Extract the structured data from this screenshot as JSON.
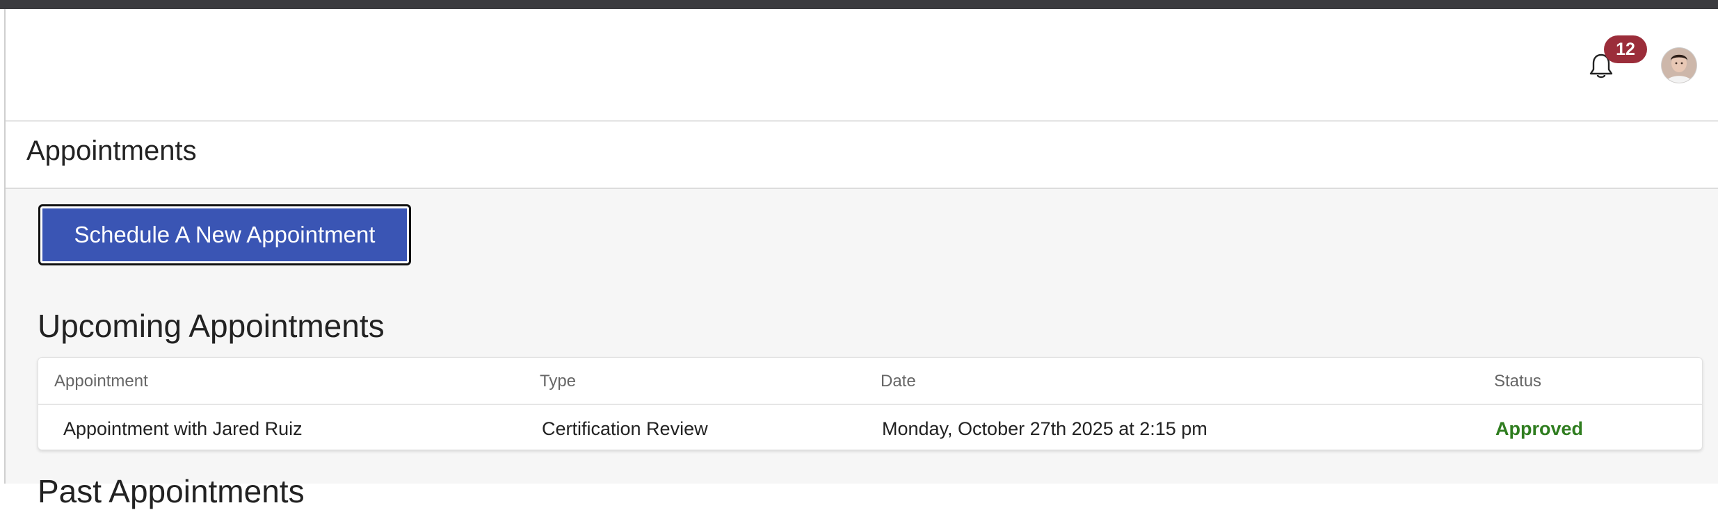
{
  "header": {
    "notifications_count": "12",
    "icons": {
      "bell": "bell-icon",
      "avatar": "user-avatar"
    }
  },
  "page": {
    "title": "Appointments"
  },
  "actions": {
    "schedule_label": "Schedule A New Appointment"
  },
  "upcoming": {
    "heading": "Upcoming Appointments",
    "columns": [
      "Appointment",
      "Type",
      "Date",
      "Status"
    ],
    "rows": [
      {
        "appointment": "Appointment with Jared Ruiz",
        "type": "Certification Review",
        "date": "Monday, October 27th 2025 at 2:15 pm",
        "status": "Approved"
      }
    ]
  },
  "past": {
    "heading": "Past Appointments"
  },
  "colors": {
    "primary_button": "#3a55b4",
    "badge": "#9b2d3a",
    "status_approved": "#2f7d1f",
    "content_bg": "#f6f6f6"
  }
}
